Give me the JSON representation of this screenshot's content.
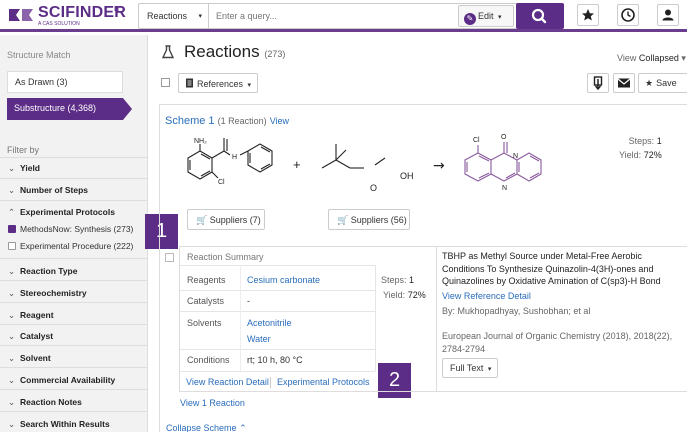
{
  "app": {
    "brand": "SCIFINDER",
    "brand_sup": "n",
    "tagline": "A CAS SOLUTION",
    "accent": "#5c2d86",
    "link_color": "#2a6ebb"
  },
  "search": {
    "scope": "Reactions",
    "placeholder": "Enter a query...",
    "edit_label": "Edit",
    "icons": [
      "search-icon",
      "star-icon",
      "clock-icon",
      "user-icon"
    ]
  },
  "sidebar": {
    "title": "Structure Match",
    "as_drawn": "As Drawn (3)",
    "substructure": "Substructure (4,368)",
    "filter_by": "Filter by",
    "filters": [
      {
        "label": "Yield",
        "expanded": false
      },
      {
        "label": "Number of Steps",
        "expanded": false
      },
      {
        "label": "Experimental Protocols",
        "expanded": true
      },
      {
        "label": "Reaction Type",
        "expanded": false
      },
      {
        "label": "Stereochemistry",
        "expanded": false
      },
      {
        "label": "Reagent",
        "expanded": false
      },
      {
        "label": "Catalyst",
        "expanded": false
      },
      {
        "label": "Solvent",
        "expanded": false
      },
      {
        "label": "Commercial Availability",
        "expanded": false
      },
      {
        "label": "Reaction Notes",
        "expanded": false
      },
      {
        "label": "Search Within Results",
        "expanded": false
      }
    ],
    "protocols": [
      {
        "label": "MethodsNow: Synthesis (273)",
        "checked": true
      },
      {
        "label": "Experimental Procedure (222)",
        "checked": false
      }
    ]
  },
  "badges": [
    "1",
    "2"
  ],
  "main": {
    "title": "Reactions",
    "count": "(273)",
    "view_label": "View",
    "view_value": "Collapsed",
    "references_label": "References",
    "save_label": "Save"
  },
  "scheme": {
    "title": "Scheme 1",
    "reaction_count": "(1 Reaction)",
    "view_link": "View",
    "steps_label": "Steps:",
    "steps_value": "1",
    "yield_label": "Yield:",
    "yield_value": "72%",
    "plus": "+",
    "arrow": "→",
    "supplier_buttons": [
      "Suppliers (7)",
      "Suppliers (56)"
    ],
    "atoms": {
      "nh2": "NH₂",
      "nh": "H",
      "n": "N",
      "cl": "Cl",
      "o": "O",
      "oh": "OH"
    },
    "collapse_label": "Collapse Scheme"
  },
  "reaction": {
    "summary_title": "Reaction Summary",
    "rows": [
      {
        "label": "Reagents",
        "values": [
          "Cesium carbonate"
        ],
        "link": true
      },
      {
        "label": "Catalysts",
        "values": [
          "-"
        ],
        "link": false
      },
      {
        "label": "Solvents",
        "values": [
          "Acetonitrile",
          "Water"
        ],
        "link": true
      },
      {
        "label": "Conditions",
        "values": [
          "rt; 10 h, 80 °C"
        ],
        "link": false
      }
    ],
    "steps_label": "Steps:",
    "steps_value": "1",
    "yield_label": "Yield:",
    "yield_value": "72%",
    "view_detail": "View Reaction Detail",
    "experimental": "Experimental Protocols",
    "view_one": "View 1 Reaction"
  },
  "reference": {
    "title": "TBHP as Methyl Source under Metal-Free Aerobic Conditions To Synthesize Quinazolin-4(3H)-ones and Quinazolines by Oxidative Amination of C(sp3)-H Bond",
    "link": "View Reference Detail",
    "by": "By: Mukhopadhyay, Sushobhan; et al",
    "journal": "European Journal of Organic Chemistry (2018), 2018(22), 2784-2794",
    "full_text": "Full Text"
  }
}
